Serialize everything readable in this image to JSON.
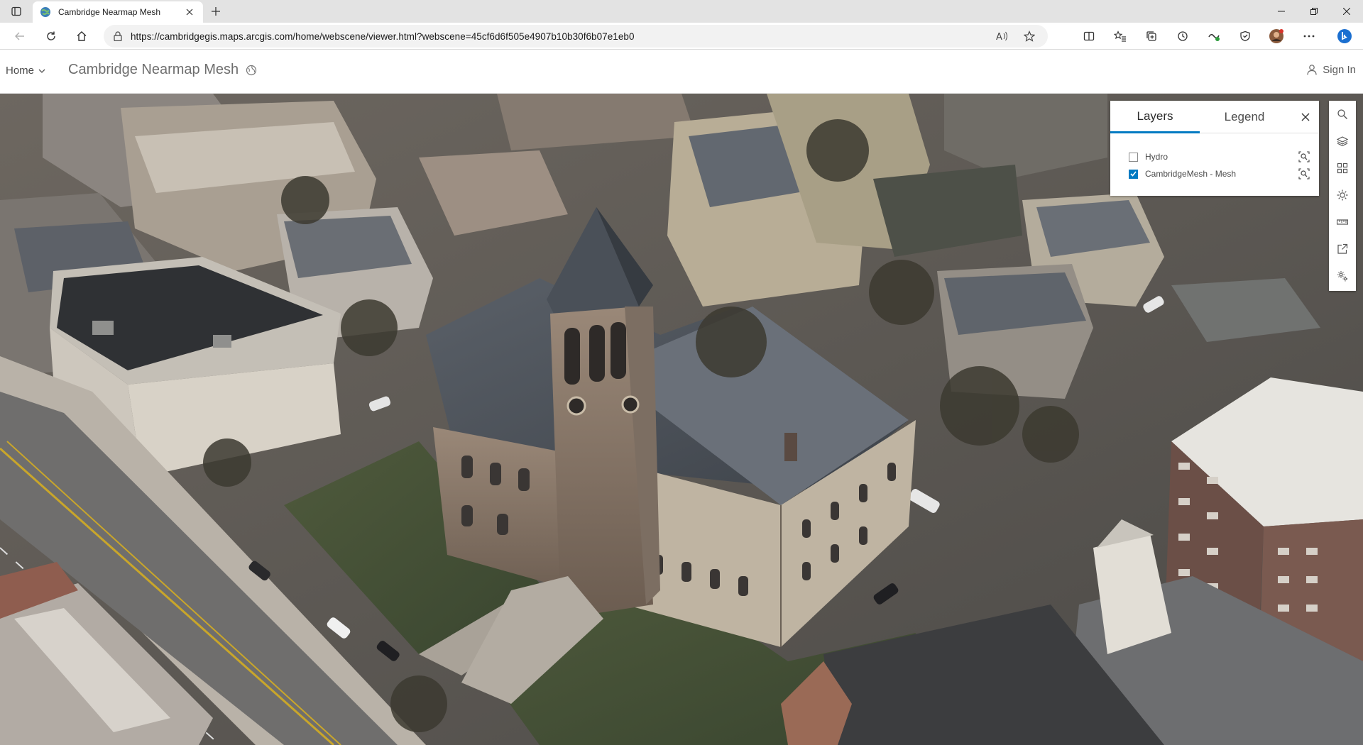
{
  "browser": {
    "tab": {
      "title": "Cambridge Nearmap Mesh"
    },
    "url": "https://cambridgegis.maps.arcgis.com/home/webscene/viewer.html?webscene=45cf6d6f505e4907b10b30f6b07e1eb0"
  },
  "header": {
    "home_label": "Home",
    "title": "Cambridge Nearmap Mesh",
    "sign_in_label": "Sign In"
  },
  "panel": {
    "tabs": [
      {
        "label": "Layers",
        "active": true
      },
      {
        "label": "Legend",
        "active": false
      }
    ],
    "layers": [
      {
        "label": "Hydro",
        "checked": false
      },
      {
        "label": "CambridgeMesh - Mesh",
        "checked": true
      }
    ]
  },
  "widgets": [
    "search-icon",
    "layers-icon",
    "basemap-gallery-icon",
    "daylight-icon",
    "measure-icon",
    "share-icon",
    "settings-icon"
  ],
  "colors": {
    "accent": "#007ac2"
  }
}
